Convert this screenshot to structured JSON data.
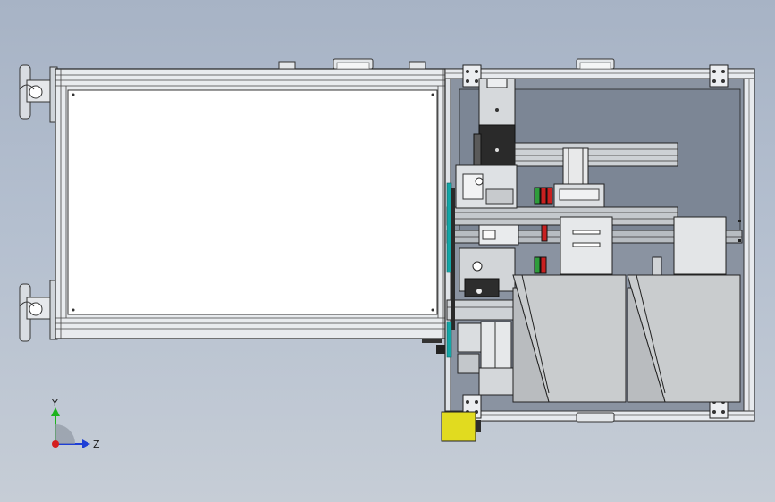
{
  "triad": {
    "y_label": "Y",
    "z_label": "Z",
    "y_color": "#1db31d",
    "z_color": "#1e3fd6",
    "x_color": "#d41e1e"
  },
  "colors": {
    "background_top": "#a7b3c5",
    "background_bottom": "#c6cdd6",
    "frame_rail": "#dfe3e8",
    "enclosure_panel": "#7e8897",
    "white_panel": "#ffffff",
    "dark_block": "#2d2d2d",
    "green_part": "#2e9c3b",
    "red_part": "#c82020",
    "cyan_part": "#12a6a6",
    "yellow_part": "#e1db1f",
    "hopper": "#c9ccce"
  },
  "icons": {
    "triad": "coordinate-triad-icon"
  }
}
